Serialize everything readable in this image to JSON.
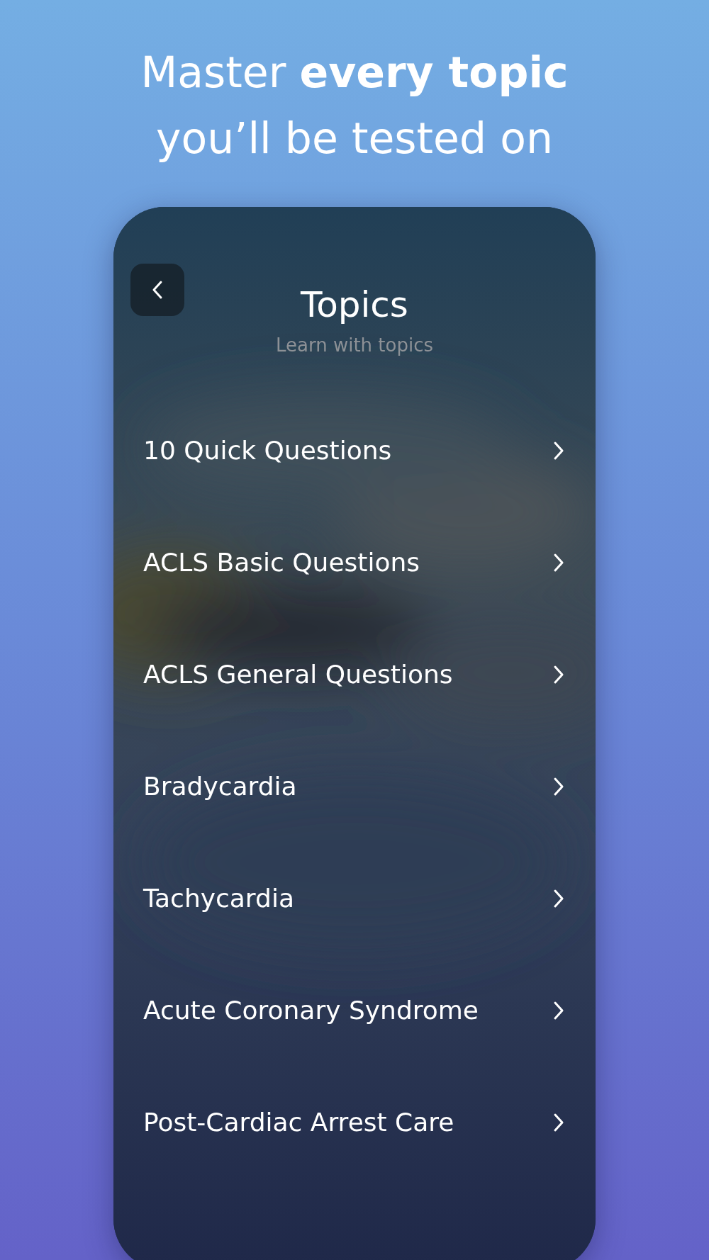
{
  "headline": "Master **every topic** you’ll be tested on",
  "screen": {
    "title": "Topics",
    "subtitle": "Learn with topics",
    "topics": [
      {
        "label": "10 Quick Questions"
      },
      {
        "label": "ACLS Basic Questions"
      },
      {
        "label": "ACLS General Questions"
      },
      {
        "label": "Bradycardia"
      },
      {
        "label": "Tachycardia"
      },
      {
        "label": "Acute Coronary Syndrome"
      },
      {
        "label": "Post-Cardiac Arrest Care"
      }
    ]
  }
}
